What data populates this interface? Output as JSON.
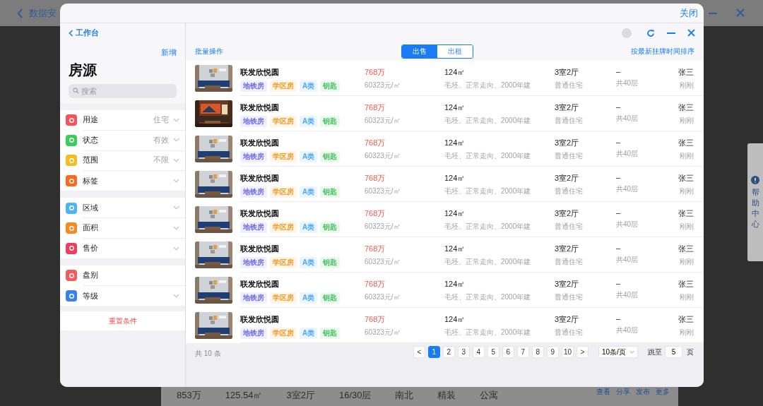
{
  "background_page": {
    "title": "数据安",
    "listing": {
      "values": [
        "853万",
        "125.54㎡",
        "3室2厅",
        "16/30层",
        "南北",
        "精装",
        "公寓"
      ],
      "actions": [
        "查看",
        "分享",
        "发布",
        "更多"
      ]
    }
  },
  "help_tab": {
    "label": "帮助中心"
  },
  "dialog": {
    "close_label": "关闭"
  },
  "sidebar": {
    "back_label": "工作台",
    "add_label": "新增",
    "title": "房源",
    "search": {
      "placeholder": "搜索"
    },
    "groups": [
      {
        "items": [
          {
            "label": "用途",
            "value": "住宅",
            "color": "#f5525a",
            "dropdown": true
          },
          {
            "label": "状态",
            "value": "有效",
            "color": "#3ccc5a",
            "dropdown": true
          },
          {
            "label": "范围",
            "value": "不限",
            "color": "#f7bb1c",
            "dropdown": true
          },
          {
            "label": "标签",
            "color": "#fb6a1e",
            "dropdown": true
          }
        ]
      },
      {
        "items": [
          {
            "label": "区域",
            "color": "#4bb4f5",
            "dropdown": true
          },
          {
            "label": "面积",
            "color": "#fb8a1e",
            "dropdown": true
          },
          {
            "label": "售价",
            "color": "#f23b5c",
            "dropdown": true
          }
        ]
      },
      {
        "items": [
          {
            "label": "盘别",
            "color": "#f55b5b",
            "dropdown": false
          },
          {
            "label": "等级",
            "color": "#3a7ff5",
            "dropdown": true
          }
        ]
      }
    ],
    "reset_label": "重置条件"
  },
  "toolbar": {
    "batch_label": "批量操作",
    "sort_label": "按最新挂牌时间排序",
    "segments": [
      {
        "label": "出售",
        "selected": true
      },
      {
        "label": "出租",
        "selected": false
      }
    ]
  },
  "listings": [
    {
      "title": "联发欣悦圆",
      "tags": [
        {
          "label": "地铁房",
          "color": "#6c6cf0"
        },
        {
          "label": "学区房",
          "color": "#f59a23"
        },
        {
          "label": "A类",
          "color": "#4aa8ff"
        },
        {
          "label": "钥匙",
          "color": "#44c25e"
        }
      ],
      "price": "768万",
      "unit_price": "60323元/㎡",
      "area": "124㎡",
      "area_desc": "毛坯、正常走向、2000年建",
      "layout": "3室2厅",
      "type": "普通住宅",
      "floor": "–",
      "floor_total": "共40层",
      "agent": "张三",
      "time": "刚刚"
    },
    {
      "title": "联发欣悦圆",
      "tags": [
        {
          "label": "地铁房",
          "color": "#6c6cf0"
        },
        {
          "label": "学区房",
          "color": "#f59a23"
        },
        {
          "label": "A类",
          "color": "#4aa8ff"
        },
        {
          "label": "钥匙",
          "color": "#44c25e"
        }
      ],
      "price": "768万",
      "unit_price": "60323元/㎡",
      "area": "124㎡",
      "area_desc": "毛坯、正常走向、2000年建",
      "layout": "3室2厅",
      "type": "普通住宅",
      "floor": "–",
      "floor_total": "共40层",
      "agent": "张三",
      "time": "刚刚"
    },
    {
      "title": "联发欣悦圆",
      "tags": [
        {
          "label": "地铁房",
          "color": "#6c6cf0"
        },
        {
          "label": "学区房",
          "color": "#f59a23"
        },
        {
          "label": "A类",
          "color": "#4aa8ff"
        },
        {
          "label": "钥匙",
          "color": "#44c25e"
        }
      ],
      "price": "768万",
      "unit_price": "60323元/㎡",
      "area": "124㎡",
      "area_desc": "毛坯、正常走向、2000年建",
      "layout": "3室2厅",
      "type": "普通住宅",
      "floor": "–",
      "floor_total": "共40层",
      "agent": "张三",
      "time": "刚刚"
    },
    {
      "title": "联发欣悦圆",
      "tags": [
        {
          "label": "地铁房",
          "color": "#6c6cf0"
        },
        {
          "label": "学区房",
          "color": "#f59a23"
        },
        {
          "label": "A类",
          "color": "#4aa8ff"
        },
        {
          "label": "钥匙",
          "color": "#44c25e"
        }
      ],
      "price": "768万",
      "unit_price": "60323元/㎡",
      "area": "124㎡",
      "area_desc": "毛坯、正常走向、2000年建",
      "layout": "3室2厅",
      "type": "普通住宅",
      "floor": "–",
      "floor_total": "共40层",
      "agent": "张三",
      "time": "刚刚"
    },
    {
      "title": "联发欣悦圆",
      "tags": [
        {
          "label": "地铁房",
          "color": "#6c6cf0"
        },
        {
          "label": "学区房",
          "color": "#f59a23"
        },
        {
          "label": "A类",
          "color": "#4aa8ff"
        },
        {
          "label": "钥匙",
          "color": "#44c25e"
        }
      ],
      "price": "768万",
      "unit_price": "60323元/㎡",
      "area": "124㎡",
      "area_desc": "毛坯、正常走向、2000年建",
      "layout": "3室2厅",
      "type": "普通住宅",
      "floor": "–",
      "floor_total": "共40层",
      "agent": "张三",
      "time": "刚刚"
    },
    {
      "title": "联发欣悦圆",
      "tags": [
        {
          "label": "地铁房",
          "color": "#6c6cf0"
        },
        {
          "label": "学区房",
          "color": "#f59a23"
        },
        {
          "label": "A类",
          "color": "#4aa8ff"
        },
        {
          "label": "钥匙",
          "color": "#44c25e"
        }
      ],
      "price": "768万",
      "unit_price": "60323元/㎡",
      "area": "124㎡",
      "area_desc": "毛坯、正常走向、2000年建",
      "layout": "3室2厅",
      "type": "普通住宅",
      "floor": "–",
      "floor_total": "共40层",
      "agent": "张三",
      "time": "刚刚"
    },
    {
      "title": "联发欣悦圆",
      "tags": [
        {
          "label": "地铁房",
          "color": "#6c6cf0"
        },
        {
          "label": "学区房",
          "color": "#f59a23"
        },
        {
          "label": "A类",
          "color": "#4aa8ff"
        },
        {
          "label": "钥匙",
          "color": "#44c25e"
        }
      ],
      "price": "768万",
      "unit_price": "60323元/㎡",
      "area": "124㎡",
      "area_desc": "毛坯、正常走向、2000年建",
      "layout": "3室2厅",
      "type": "普通住宅",
      "floor": "–",
      "floor_total": "共40层",
      "agent": "张三",
      "time": "刚刚"
    },
    {
      "title": "联发欣悦圆",
      "tags": [
        {
          "label": "地铁房",
          "color": "#6c6cf0"
        },
        {
          "label": "学区房",
          "color": "#f59a23"
        },
        {
          "label": "A类",
          "color": "#4aa8ff"
        },
        {
          "label": "钥匙",
          "color": "#44c25e"
        }
      ],
      "price": "768万",
      "unit_price": "60323元/㎡",
      "area": "124㎡",
      "area_desc": "毛坯、正常走向、2000年建",
      "layout": "3室2厅",
      "type": "普通住宅",
      "floor": "–",
      "floor_total": "共40层",
      "agent": "张三",
      "time": "刚刚"
    }
  ],
  "footer": {
    "total": "共 10 条",
    "prev": "<",
    "next": ">",
    "pages": [
      {
        "label": "1",
        "selected": true
      },
      {
        "label": "2",
        "selected": false
      },
      {
        "label": "3",
        "selected": false
      },
      {
        "label": "4",
        "selected": false
      },
      {
        "label": "5",
        "selected": false
      },
      {
        "label": "6",
        "selected": false
      },
      {
        "label": "7",
        "selected": false
      },
      {
        "label": "8",
        "selected": false
      },
      {
        "label": "9",
        "selected": false
      },
      {
        "label": "10",
        "selected": false
      }
    ],
    "page_size": "10条/页",
    "jump_label": "跳至",
    "jump_value": "5",
    "page_unit": "页"
  }
}
